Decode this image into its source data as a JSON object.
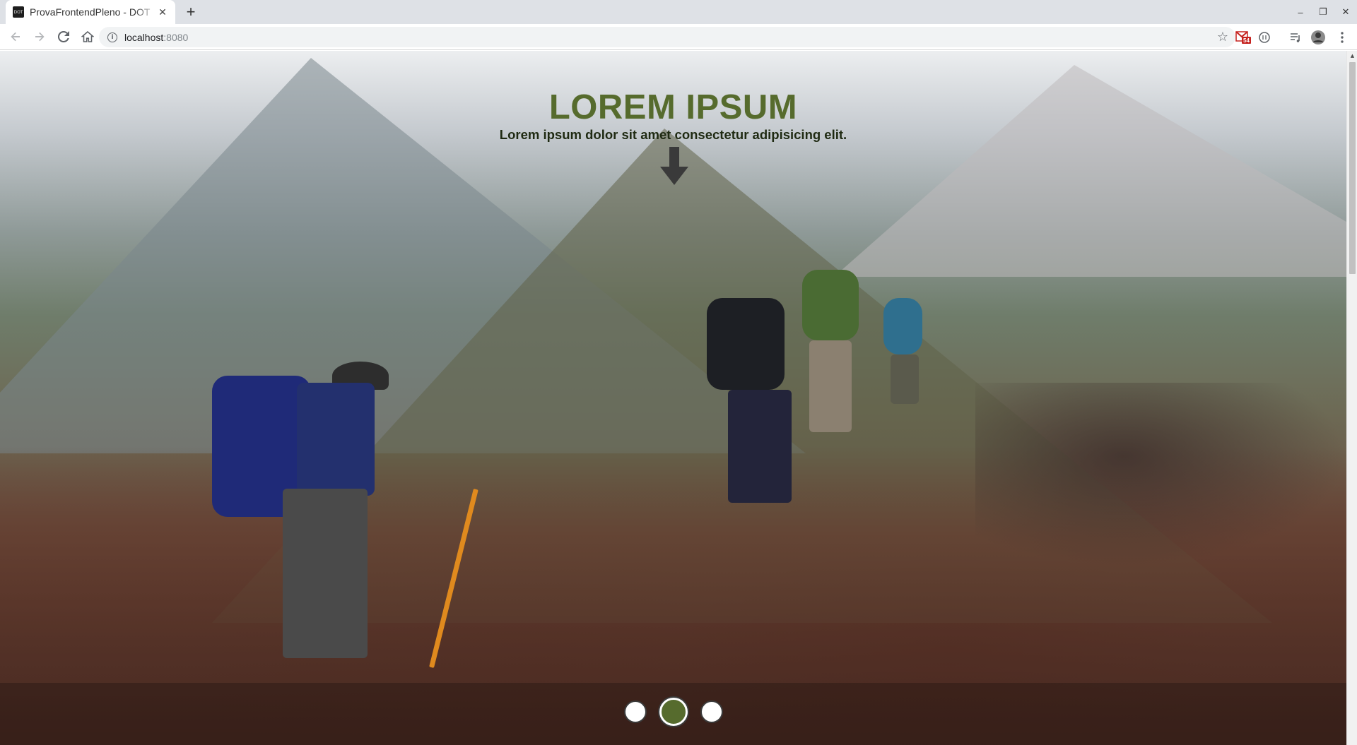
{
  "browser": {
    "tab_title": "ProvaFrontendPleno - DOT",
    "favicon_text": "DOT",
    "close_tab_glyph": "✕",
    "new_tab_glyph": "+",
    "url_host": "localhost",
    "url_port": ":8080",
    "bookmark_glyph": "☆",
    "info_glyph": "i",
    "gmail_badge": "54",
    "window_controls": {
      "minimize": "–",
      "restore": "❐",
      "close": "✕"
    },
    "scroll_up_glyph": "▲"
  },
  "hero": {
    "title": "LOREM IPSUM",
    "subtitle": "Lorem ipsum dolor sit amet consectetur adipisicing elit.",
    "accent_color": "#566b2d",
    "background_image": "hikers climbing a rocky mountain trail"
  },
  "carousel": {
    "dot_count": 3,
    "active_index": 1
  }
}
